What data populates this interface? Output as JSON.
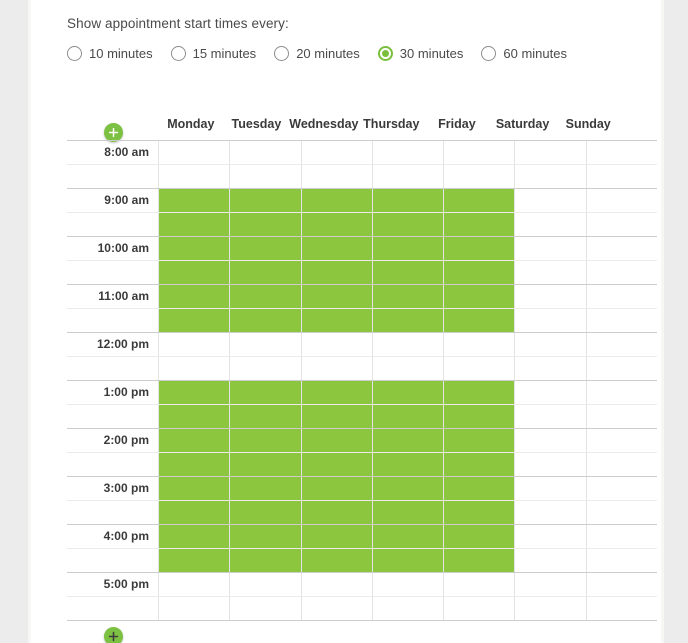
{
  "options": {
    "title": "Show appointment start times every:",
    "selected": "30 minutes",
    "choices": [
      {
        "label": "10 minutes",
        "selected": false
      },
      {
        "label": "15 minutes",
        "selected": false
      },
      {
        "label": "20 minutes",
        "selected": false
      },
      {
        "label": "30 minutes",
        "selected": true
      },
      {
        "label": "60 minutes",
        "selected": false
      }
    ]
  },
  "schedule": {
    "add_row_top_label": "+",
    "add_row_bottom_label": "+",
    "days": [
      "Monday",
      "Tuesday",
      "Wednesday",
      "Thursday",
      "Friday",
      "Saturday",
      "Sunday"
    ],
    "available_color": "#8cc63e",
    "accent_color": "#7dc143",
    "slots": [
      {
        "time": "8:00 am",
        "hour_start": true,
        "availability": [
          false,
          false,
          false,
          false,
          false,
          false,
          false
        ]
      },
      {
        "time": "",
        "hour_start": false,
        "availability": [
          false,
          false,
          false,
          false,
          false,
          false,
          false
        ]
      },
      {
        "time": "9:00 am",
        "hour_start": true,
        "availability": [
          true,
          true,
          true,
          true,
          true,
          false,
          false
        ]
      },
      {
        "time": "",
        "hour_start": false,
        "availability": [
          true,
          true,
          true,
          true,
          true,
          false,
          false
        ]
      },
      {
        "time": "10:00 am",
        "hour_start": true,
        "availability": [
          true,
          true,
          true,
          true,
          true,
          false,
          false
        ]
      },
      {
        "time": "",
        "hour_start": false,
        "availability": [
          true,
          true,
          true,
          true,
          true,
          false,
          false
        ]
      },
      {
        "time": "11:00 am",
        "hour_start": true,
        "availability": [
          true,
          true,
          true,
          true,
          true,
          false,
          false
        ]
      },
      {
        "time": "",
        "hour_start": false,
        "availability": [
          true,
          true,
          true,
          true,
          true,
          false,
          false
        ]
      },
      {
        "time": "12:00 pm",
        "hour_start": true,
        "availability": [
          false,
          false,
          false,
          false,
          false,
          false,
          false
        ]
      },
      {
        "time": "",
        "hour_start": false,
        "availability": [
          false,
          false,
          false,
          false,
          false,
          false,
          false
        ]
      },
      {
        "time": "1:00 pm",
        "hour_start": true,
        "availability": [
          true,
          true,
          true,
          true,
          true,
          false,
          false
        ]
      },
      {
        "time": "",
        "hour_start": false,
        "availability": [
          true,
          true,
          true,
          true,
          true,
          false,
          false
        ]
      },
      {
        "time": "2:00 pm",
        "hour_start": true,
        "availability": [
          true,
          true,
          true,
          true,
          true,
          false,
          false
        ]
      },
      {
        "time": "",
        "hour_start": false,
        "availability": [
          true,
          true,
          true,
          true,
          true,
          false,
          false
        ]
      },
      {
        "time": "3:00 pm",
        "hour_start": true,
        "availability": [
          true,
          true,
          true,
          true,
          true,
          false,
          false
        ]
      },
      {
        "time": "",
        "hour_start": false,
        "availability": [
          true,
          true,
          true,
          true,
          true,
          false,
          false
        ]
      },
      {
        "time": "4:00 pm",
        "hour_start": true,
        "availability": [
          true,
          true,
          true,
          true,
          true,
          false,
          false
        ]
      },
      {
        "time": "",
        "hour_start": false,
        "availability": [
          true,
          true,
          true,
          true,
          true,
          false,
          false
        ]
      },
      {
        "time": "5:00 pm",
        "hour_start": true,
        "availability": [
          false,
          false,
          false,
          false,
          false,
          false,
          false
        ]
      },
      {
        "time": "",
        "hour_start": false,
        "availability": [
          false,
          false,
          false,
          false,
          false,
          false,
          false
        ]
      }
    ]
  }
}
